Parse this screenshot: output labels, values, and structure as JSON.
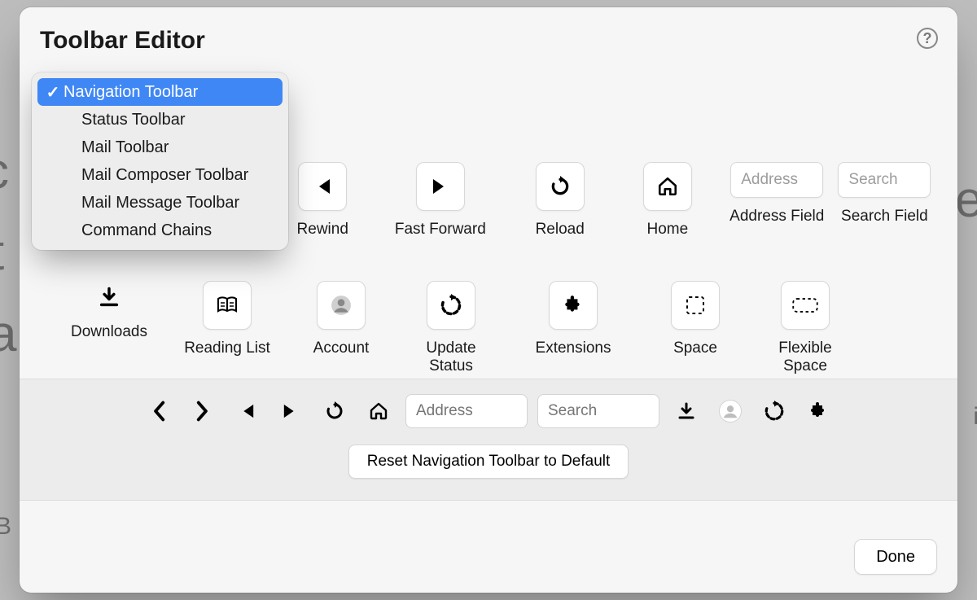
{
  "title": "Toolbar Editor",
  "help_tooltip": "?",
  "dropdown": {
    "items": [
      {
        "label": "Navigation Toolbar",
        "selected": true
      },
      {
        "label": "Status Toolbar"
      },
      {
        "label": "Mail Toolbar"
      },
      {
        "label": "Mail Composer Toolbar"
      },
      {
        "label": "Mail Message Toolbar"
      },
      {
        "label": "Command Chains"
      }
    ]
  },
  "row1": [
    {
      "icon": "rewind-icon",
      "label": "Rewind"
    },
    {
      "icon": "fast-forward-icon",
      "label": "Fast Forward"
    },
    {
      "icon": "reload-icon",
      "label": "Reload"
    },
    {
      "icon": "home-icon",
      "label": "Home"
    },
    {
      "icon": "address-field",
      "label": "Address Field",
      "field_placeholder": "Address"
    },
    {
      "icon": "search-field",
      "label": "Search Field",
      "field_placeholder": "Search"
    }
  ],
  "row2": [
    {
      "icon": "downloads-icon",
      "label": "Downloads"
    },
    {
      "icon": "reading-list-icon",
      "label": "Reading List"
    },
    {
      "icon": "account-icon",
      "label": "Account"
    },
    {
      "icon": "update-status-icon",
      "label": "Update Status"
    },
    {
      "icon": "extensions-icon",
      "label": "Extensions"
    },
    {
      "icon": "space-icon",
      "label": "Space"
    },
    {
      "icon": "flexible-space-icon",
      "label": "Flexible Space"
    }
  ],
  "preview": {
    "address_placeholder": "Address",
    "search_placeholder": "Search",
    "reset_label": "Reset Navigation Toolbar to Default"
  },
  "done_label": "Done"
}
